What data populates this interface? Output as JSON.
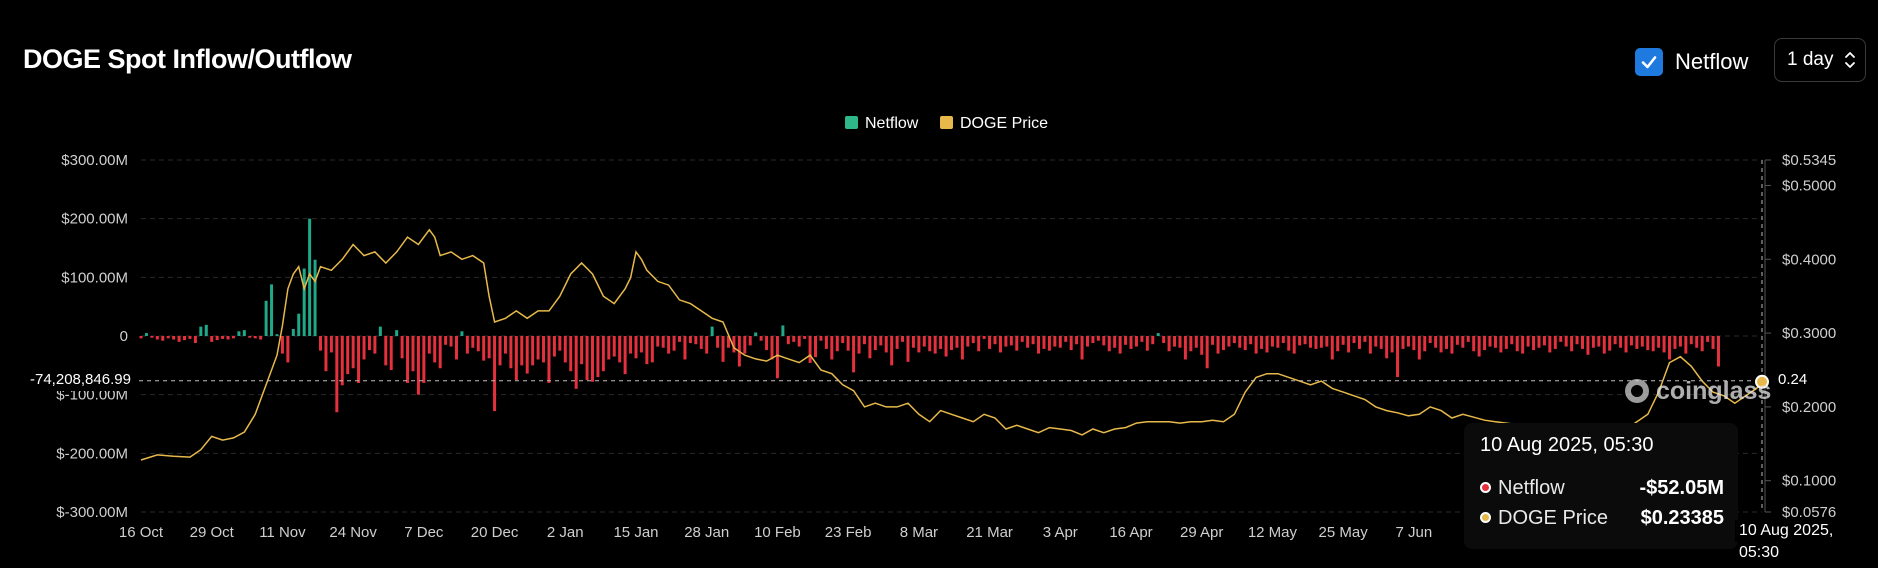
{
  "header": {
    "title": "DOGE Spot Inflow/Outflow",
    "netflow_toggle": {
      "label": "Netflow",
      "checked": true
    },
    "interval": {
      "value": "1 day"
    }
  },
  "legend": [
    {
      "name": "Netflow",
      "color": "#2eb88a"
    },
    {
      "name": "DOGE Price",
      "color": "#e6b94a"
    }
  ],
  "colors": {
    "positive": "#1fa88a",
    "negative": "#e5303d",
    "price": "#e6b94a",
    "grid": "#2a2a2a"
  },
  "crosshair": {
    "left_value": "-74,208,846.99",
    "right_value": "0.24",
    "x_label": "10 Aug 2025, 05:30"
  },
  "tooltip": {
    "date": "10 Aug 2025, 05:30",
    "rows": [
      {
        "name": "Netflow",
        "value": "-$52.05M",
        "dot_color": "#e5303d"
      },
      {
        "name": "DOGE Price",
        "value": "$0.23385",
        "dot_color": "#e6b94a"
      }
    ]
  },
  "watermark": {
    "text": "coinglass"
  },
  "chart_data": {
    "type": "bar",
    "y_left": {
      "ticks": [
        {
          "value": 300,
          "label": "$300.00M"
        },
        {
          "value": 200,
          "label": "$200.00M"
        },
        {
          "value": 100,
          "label": "$100.00M"
        },
        {
          "value": 0,
          "label": "0"
        },
        {
          "value": -100,
          "label": "$-100.00M"
        },
        {
          "value": -200,
          "label": "$-200.00M"
        },
        {
          "value": -300,
          "label": "$-300.00M"
        }
      ],
      "range": [
        -300,
        300
      ]
    },
    "y_right": {
      "ticks": [
        {
          "value": 0.5345,
          "label": "$0.5345"
        },
        {
          "value": 0.5,
          "label": "$0.5000"
        },
        {
          "value": 0.4,
          "label": "$0.4000"
        },
        {
          "value": 0.3,
          "label": "$0.3000"
        },
        {
          "value": 0.2,
          "label": "$0.2000"
        },
        {
          "value": 0.1,
          "label": "$0.1000"
        },
        {
          "value": 0.0576,
          "label": "$0.0576"
        }
      ],
      "range": [
        0.0576,
        0.5345
      ]
    },
    "x_ticks": [
      {
        "day": 0,
        "label": "16 Oct"
      },
      {
        "day": 13,
        "label": "29 Oct"
      },
      {
        "day": 26,
        "label": "11 Nov"
      },
      {
        "day": 39,
        "label": "24 Nov"
      },
      {
        "day": 52,
        "label": "7 Dec"
      },
      {
        "day": 65,
        "label": "20 Dec"
      },
      {
        "day": 78,
        "label": "2 Jan"
      },
      {
        "day": 91,
        "label": "15 Jan"
      },
      {
        "day": 104,
        "label": "28 Jan"
      },
      {
        "day": 117,
        "label": "10 Feb"
      },
      {
        "day": 130,
        "label": "23 Feb"
      },
      {
        "day": 143,
        "label": "8 Mar"
      },
      {
        "day": 156,
        "label": "21 Mar"
      },
      {
        "day": 169,
        "label": "3 Apr"
      },
      {
        "day": 182,
        "label": "16 Apr"
      },
      {
        "day": 195,
        "label": "29 Apr"
      },
      {
        "day": 208,
        "label": "12 May"
      },
      {
        "day": 221,
        "label": "25 May"
      },
      {
        "day": 234,
        "label": "7 Jun"
      }
    ],
    "x_range_days": [
      0,
      298
    ],
    "netflow_series": {
      "name": "Netflow",
      "values_musd": [
        -4,
        5,
        -3,
        -6,
        -8,
        -4,
        -6,
        -10,
        -7,
        -5,
        -12,
        16,
        19,
        -10,
        -7,
        -5,
        -6,
        -4,
        8,
        10,
        -3,
        -4,
        -6,
        60,
        88,
        3,
        -30,
        -45,
        12,
        38,
        115,
        200,
        130,
        -25,
        -60,
        -28,
        -130,
        -84,
        -65,
        -55,
        -80,
        -40,
        -24,
        -30,
        16,
        -50,
        -58,
        10,
        -38,
        -80,
        -60,
        -100,
        -80,
        -30,
        -45,
        -55,
        -15,
        -18,
        -40,
        8,
        -30,
        -20,
        -26,
        -42,
        -38,
        -128,
        -50,
        -30,
        -55,
        -75,
        -50,
        -64,
        -50,
        -40,
        -45,
        -80,
        -35,
        -25,
        -45,
        -60,
        -90,
        -48,
        -75,
        -78,
        -70,
        -60,
        -40,
        -35,
        -45,
        -65,
        -30,
        -38,
        -28,
        -48,
        -45,
        -18,
        -20,
        -30,
        -25,
        -10,
        -40,
        -12,
        -14,
        -22,
        -30,
        16,
        -20,
        -44,
        -20,
        -28,
        -52,
        -30,
        -16,
        6,
        -8,
        -24,
        -40,
        -72,
        18,
        -14,
        -10,
        -18,
        -5,
        -46,
        -36,
        -8,
        -22,
        -40,
        -26,
        -12,
        -25,
        -62,
        -30,
        -14,
        -38,
        -24,
        -16,
        -28,
        -50,
        -22,
        -10,
        -44,
        -20,
        -28,
        -18,
        -26,
        -30,
        -22,
        -35,
        -24,
        -20,
        -40,
        -18,
        -12,
        -26,
        -5,
        -22,
        -14,
        -28,
        -18,
        -16,
        -25,
        -10,
        -20,
        -14,
        -30,
        -22,
        -25,
        -18,
        -20,
        -10,
        -24,
        -14,
        -40,
        -18,
        -12,
        -8,
        -16,
        -26,
        -20,
        -30,
        -15,
        -22,
        -18,
        -10,
        -25,
        -14,
        5,
        -12,
        -26,
        -18,
        -20,
        -40,
        -26,
        -20,
        -32,
        -55,
        -15,
        -30,
        -24,
        -18,
        -12,
        -20,
        -24,
        -14,
        -30,
        -22,
        -28,
        -18,
        -20,
        -12,
        -25,
        -30,
        -16,
        -14,
        -20,
        -22,
        -20,
        -18,
        -40,
        -26,
        -15,
        -28,
        -12,
        -22,
        -10,
        -30,
        -18,
        -22,
        -38,
        -28,
        -70,
        -22,
        -18,
        -24,
        -40,
        -26,
        -12,
        -20,
        -28,
        -22,
        -30,
        -15,
        -20,
        -10,
        -26,
        -35,
        -24,
        -18,
        -20,
        -28,
        -22,
        -14,
        -26,
        -30,
        -18,
        -24,
        -20,
        -16,
        -28,
        -22,
        -10,
        -18,
        -26,
        -14,
        -22,
        -32,
        -20,
        -18,
        -30,
        -25,
        -14,
        -20,
        -28,
        -16,
        -22,
        -18,
        -24,
        -26,
        -20,
        -28,
        -40,
        -22,
        -18,
        -30,
        -14,
        -20,
        -26,
        -10,
        -22,
        -52
      ]
    },
    "price_series": {
      "name": "DOGE Price",
      "points": [
        [
          0,
          0.128
        ],
        [
          3,
          0.135
        ],
        [
          6,
          0.133
        ],
        [
          9,
          0.132
        ],
        [
          11,
          0.142
        ],
        [
          13,
          0.16
        ],
        [
          15,
          0.155
        ],
        [
          17,
          0.158
        ],
        [
          19,
          0.166
        ],
        [
          21,
          0.19
        ],
        [
          23,
          0.23
        ],
        [
          25,
          0.27
        ],
        [
          26,
          0.31
        ],
        [
          27,
          0.36
        ],
        [
          28,
          0.38
        ],
        [
          29,
          0.39
        ],
        [
          30,
          0.36
        ],
        [
          31,
          0.38
        ],
        [
          32,
          0.37
        ],
        [
          33,
          0.39
        ],
        [
          35,
          0.385
        ],
        [
          37,
          0.4
        ],
        [
          39,
          0.42
        ],
        [
          41,
          0.405
        ],
        [
          43,
          0.41
        ],
        [
          45,
          0.395
        ],
        [
          47,
          0.41
        ],
        [
          49,
          0.43
        ],
        [
          51,
          0.42
        ],
        [
          53,
          0.44
        ],
        [
          54,
          0.43
        ],
        [
          55,
          0.405
        ],
        [
          57,
          0.41
        ],
        [
          59,
          0.4
        ],
        [
          61,
          0.405
        ],
        [
          63,
          0.395
        ],
        [
          64,
          0.35
        ],
        [
          65,
          0.315
        ],
        [
          67,
          0.32
        ],
        [
          69,
          0.33
        ],
        [
          71,
          0.32
        ],
        [
          73,
          0.33
        ],
        [
          75,
          0.33
        ],
        [
          77,
          0.35
        ],
        [
          79,
          0.38
        ],
        [
          81,
          0.395
        ],
        [
          83,
          0.38
        ],
        [
          85,
          0.35
        ],
        [
          87,
          0.34
        ],
        [
          89,
          0.36
        ],
        [
          90,
          0.375
        ],
        [
          91,
          0.41
        ],
        [
          92,
          0.4
        ],
        [
          93,
          0.385
        ],
        [
          95,
          0.37
        ],
        [
          97,
          0.365
        ],
        [
          99,
          0.345
        ],
        [
          101,
          0.34
        ],
        [
          103,
          0.33
        ],
        [
          105,
          0.32
        ],
        [
          107,
          0.315
        ],
        [
          109,
          0.28
        ],
        [
          111,
          0.27
        ],
        [
          113,
          0.265
        ],
        [
          115,
          0.262
        ],
        [
          117,
          0.27
        ],
        [
          119,
          0.265
        ],
        [
          121,
          0.26
        ],
        [
          123,
          0.27
        ],
        [
          125,
          0.25
        ],
        [
          127,
          0.245
        ],
        [
          129,
          0.23
        ],
        [
          131,
          0.222
        ],
        [
          133,
          0.2
        ],
        [
          135,
          0.205
        ],
        [
          137,
          0.2
        ],
        [
          139,
          0.2
        ],
        [
          141,
          0.205
        ],
        [
          143,
          0.19
        ],
        [
          145,
          0.18
        ],
        [
          147,
          0.195
        ],
        [
          149,
          0.19
        ],
        [
          151,
          0.185
        ],
        [
          153,
          0.18
        ],
        [
          155,
          0.19
        ],
        [
          157,
          0.185
        ],
        [
          159,
          0.17
        ],
        [
          161,
          0.175
        ],
        [
          163,
          0.17
        ],
        [
          165,
          0.165
        ],
        [
          167,
          0.172
        ],
        [
          169,
          0.17
        ],
        [
          171,
          0.168
        ],
        [
          173,
          0.162
        ],
        [
          175,
          0.17
        ],
        [
          177,
          0.165
        ],
        [
          179,
          0.17
        ],
        [
          181,
          0.172
        ],
        [
          183,
          0.178
        ],
        [
          185,
          0.18
        ],
        [
          187,
          0.18
        ],
        [
          189,
          0.18
        ],
        [
          191,
          0.178
        ],
        [
          193,
          0.18
        ],
        [
          195,
          0.18
        ],
        [
          197,
          0.182
        ],
        [
          199,
          0.18
        ],
        [
          201,
          0.19
        ],
        [
          203,
          0.22
        ],
        [
          205,
          0.24
        ],
        [
          207,
          0.245
        ],
        [
          209,
          0.245
        ],
        [
          211,
          0.24
        ],
        [
          213,
          0.235
        ],
        [
          215,
          0.23
        ],
        [
          217,
          0.235
        ],
        [
          219,
          0.225
        ],
        [
          221,
          0.22
        ],
        [
          223,
          0.215
        ],
        [
          225,
          0.21
        ],
        [
          227,
          0.2
        ],
        [
          229,
          0.195
        ],
        [
          231,
          0.192
        ],
        [
          233,
          0.188
        ],
        [
          235,
          0.19
        ],
        [
          237,
          0.2
        ],
        [
          239,
          0.195
        ],
        [
          241,
          0.185
        ],
        [
          243,
          0.19
        ],
        [
          245,
          0.186
        ],
        [
          247,
          0.182
        ],
        [
          249,
          0.18
        ],
        [
          251,
          0.178
        ],
        [
          253,
          0.176
        ],
        [
          255,
          0.175
        ],
        [
          257,
          0.172
        ],
        [
          259,
          0.17
        ],
        [
          261,
          0.168
        ],
        [
          263,
          0.165
        ],
        [
          265,
          0.168
        ],
        [
          267,
          0.17
        ],
        [
          269,
          0.165
        ],
        [
          271,
          0.162
        ],
        [
          273,
          0.17
        ],
        [
          275,
          0.18
        ],
        [
          277,
          0.19
        ],
        [
          279,
          0.22
        ],
        [
          281,
          0.26
        ],
        [
          283,
          0.268
        ],
        [
          285,
          0.255
        ],
        [
          287,
          0.235
        ],
        [
          289,
          0.22
        ],
        [
          291,
          0.215
        ],
        [
          293,
          0.205
        ],
        [
          295,
          0.215
        ],
        [
          297,
          0.225
        ],
        [
          298,
          0.234
        ]
      ]
    },
    "legend_position": "top-center",
    "grid": true
  }
}
